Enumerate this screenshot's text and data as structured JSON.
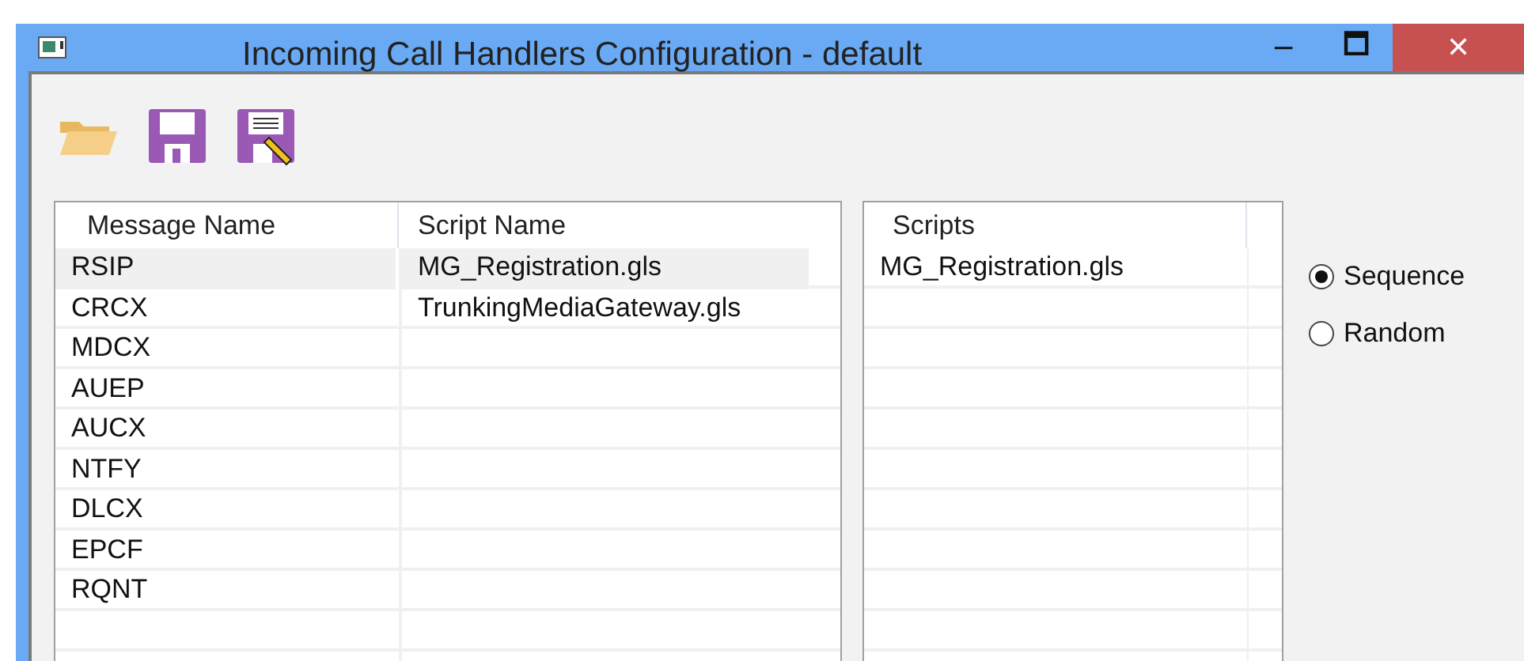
{
  "window": {
    "title": "Incoming Call Handlers Configuration - default",
    "controls": [
      "−",
      "🗖",
      "✕"
    ]
  },
  "table": {
    "columns": [
      "Message Name",
      "Script Name"
    ],
    "rows": [
      {
        "message": "RSIP",
        "script": "MG_Registration.gls",
        "selected": true
      },
      {
        "message": "CRCX",
        "script": "TrunkingMediaGateway.gls",
        "selected": false
      },
      {
        "message": "MDCX",
        "selected": false
      },
      {
        "message": "AUEP",
        "selected": false
      },
      {
        "message": "AUCX",
        "selected": false
      },
      {
        "message": "NTFY",
        "selected": false
      },
      {
        "message": "DLCX",
        "selected": false
      },
      {
        "message": "EPCF",
        "selected": false
      },
      {
        "message": "RQNT",
        "selected": false
      }
    ]
  },
  "scripts": {
    "column": "Scripts",
    "items": [
      "MG_Registration.gls"
    ]
  },
  "order": [
    {
      "label": "Sequence",
      "selected": true
    },
    {
      "label": "Random",
      "selected": false
    }
  ]
}
